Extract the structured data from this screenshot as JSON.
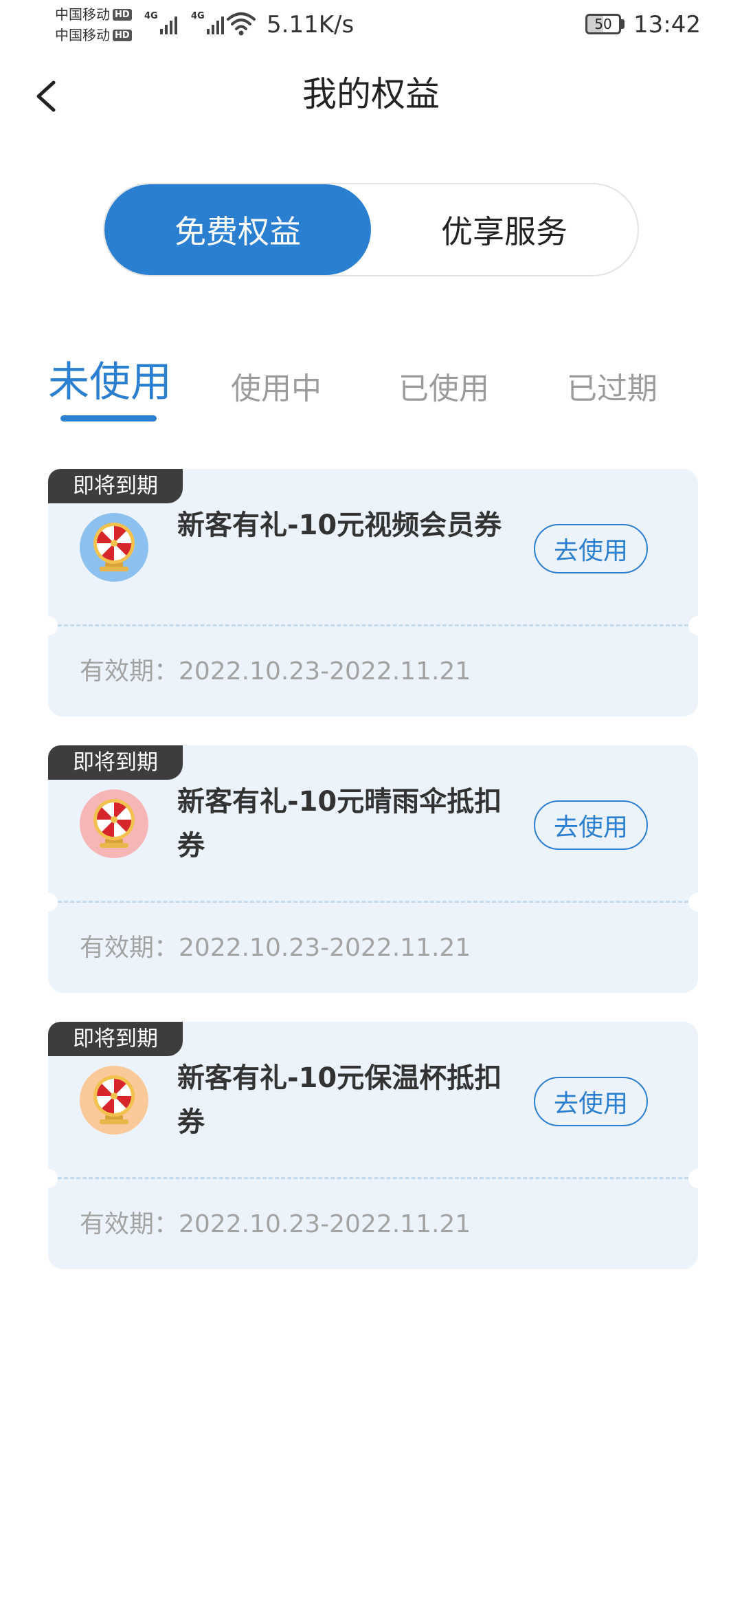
{
  "status_bar": {
    "carrier_1": "中国移动",
    "carrier_2": "中国移动",
    "hd_label": "HD",
    "network_1": "4G",
    "network_2": "4G",
    "speed": "5.11K/s",
    "battery": "50",
    "time": "13:42"
  },
  "header": {
    "title": "我的权益",
    "back_icon": "chevron-left-icon"
  },
  "segment": {
    "options": [
      "免费权益",
      "优享服务"
    ],
    "active_index": 0
  },
  "tabs": {
    "items": [
      "未使用",
      "使用中",
      "已使用",
      "已过期"
    ],
    "active_index": 0
  },
  "colors": {
    "accent": "#2b7fd1",
    "card_bg": "#ecf3fa",
    "badge_bg": "#3d3d3d",
    "icon_bg_blue": "#8cc0ef",
    "icon_bg_pink": "#f7b6b6",
    "icon_bg_orange": "#f9c99a"
  },
  "coupons": [
    {
      "badge": "即将到期",
      "title": "新客有礼-10元视频会员券",
      "button": "去使用",
      "validity": "有效期：2022.10.23-2022.11.21",
      "icon": "prize-wheel-icon",
      "icon_bg": "#8cc0ef"
    },
    {
      "badge": "即将到期",
      "title": "新客有礼-10元晴雨伞抵扣券",
      "button": "去使用",
      "validity": "有效期：2022.10.23-2022.11.21",
      "icon": "prize-wheel-icon",
      "icon_bg": "#f7b6b6"
    },
    {
      "badge": "即将到期",
      "title": "新客有礼-10元保温杯抵扣券",
      "button": "去使用",
      "validity": "有效期：2022.10.23-2022.11.21",
      "icon": "prize-wheel-icon",
      "icon_bg": "#f9c99a"
    }
  ]
}
